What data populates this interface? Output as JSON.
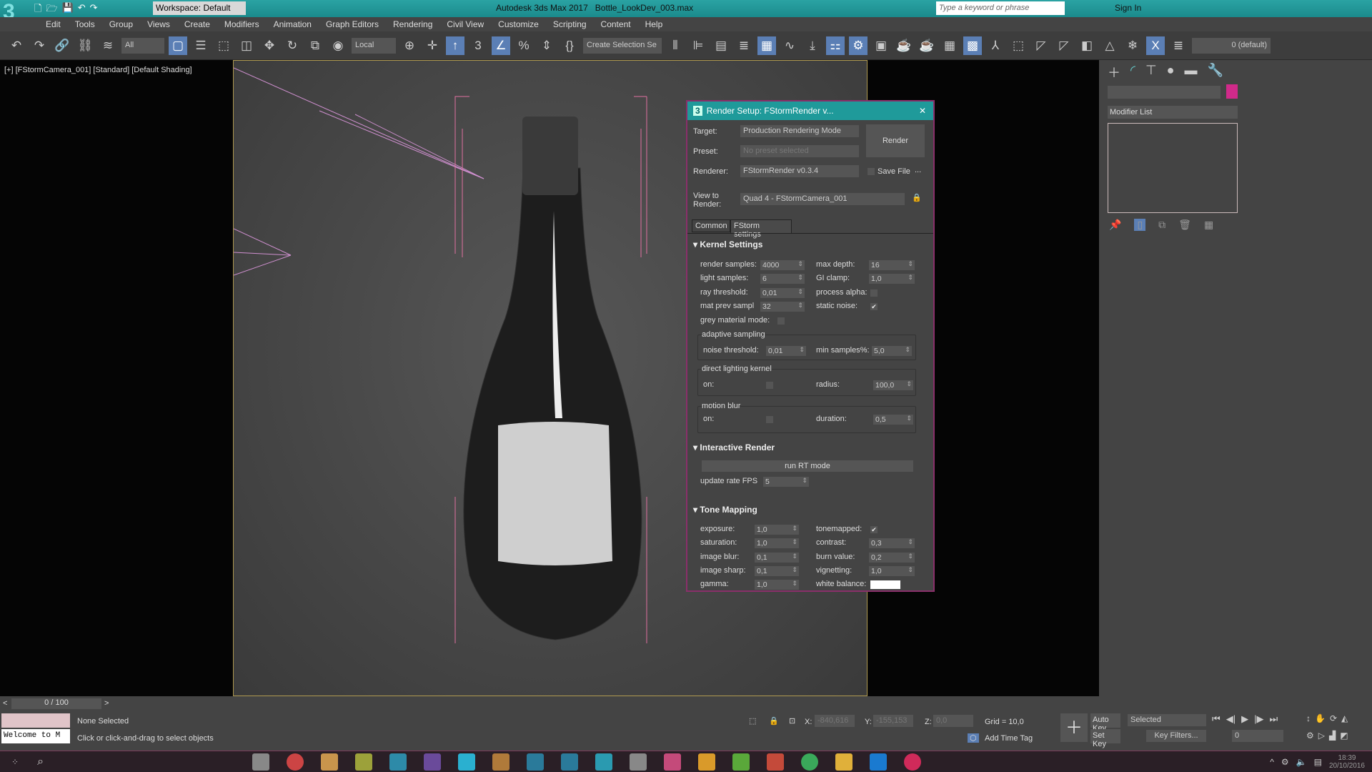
{
  "app": {
    "title": "Autodesk 3ds Max 2017",
    "file": "Bottle_LookDev_003.max",
    "workspace": "Workspace: Default",
    "search_placeholder": "Type a keyword or phrase",
    "sign_in": "Sign In",
    "logo": "3"
  },
  "menu": [
    "Edit",
    "Tools",
    "Group",
    "Views",
    "Create",
    "Modifiers",
    "Animation",
    "Graph Editors",
    "Rendering",
    "Civil View",
    "Customize",
    "Scripting",
    "Content",
    "Help"
  ],
  "toolbar": {
    "filter": "All",
    "coord": "Local",
    "selection_set": "Create Selection Se",
    "layer": "0 (default)"
  },
  "viewport": {
    "label": "[+] [FStormCamera_001] [Standard] [Default Shading]"
  },
  "dialog": {
    "title": "Render Setup: FStormRender v...",
    "target_label": "Target:",
    "target": "Production Rendering Mode",
    "preset_label": "Preset:",
    "preset": "No preset selected",
    "renderer_label": "Renderer:",
    "renderer": "FStormRender v0.3.4",
    "save_file": "Save File",
    "more": "...",
    "view_label": "View to Render:",
    "view": "Quad 4 - FStormCamera_001",
    "render_button": "Render",
    "tabs": [
      "Common",
      "FStorm settings"
    ],
    "kernel": {
      "title": "Kernel Settings",
      "render_samples_l": "render samples:",
      "render_samples": "4000",
      "max_depth_l": "max depth:",
      "max_depth": "16",
      "light_samples_l": "light samples:",
      "light_samples": "6",
      "gi_clamp_l": "GI clamp:",
      "gi_clamp": "1,0",
      "ray_threshold_l": "ray threshold:",
      "ray_threshold": "0,01",
      "process_alpha_l": "process alpha:",
      "mat_prev_l": "mat prev sampl",
      "mat_prev": "32",
      "static_noise_l": "static noise:",
      "grey_l": "grey material mode:",
      "adaptive": "adaptive sampling",
      "noise_l": "noise threshold:",
      "noise": "0,01",
      "min_samples_l": "min samples%:",
      "min_samples": "5,0",
      "dlk": "direct lighting kernel",
      "on_l": "on:",
      "radius_l": "radius:",
      "radius": "100,0",
      "mb": "motion blur",
      "duration_l": "duration:",
      "duration": "0,5"
    },
    "interactive": {
      "title": "Interactive Render",
      "rt": "run RT mode",
      "fps_l": "update rate FPS",
      "fps": "5"
    },
    "tone": {
      "title": "Tone Mapping",
      "exposure_l": "exposure:",
      "exposure": "1,0",
      "tonemapped_l": "tonemapped:",
      "saturation_l": "saturation:",
      "saturation": "1,0",
      "contrast_l": "contrast:",
      "contrast": "0,3",
      "blur_l": "image blur:",
      "blur": "0,1",
      "burn_l": "burn value:",
      "burn": "0,2",
      "sharp_l": "image sharp:",
      "sharp": "0,1",
      "vignetting_l": "vignetting:",
      "vignetting": "1,0",
      "gamma_l": "gamma:",
      "gamma": "1,0",
      "wb_l": "white balance:"
    }
  },
  "command_panel": {
    "modifier_list": "Modifier List",
    "color": "#d02a8a"
  },
  "timeline": {
    "frame": "0 / 100"
  },
  "status": {
    "selected": "None Selected",
    "prompt": "Click or click-and-drag to select objects",
    "listener": "Welcome to M",
    "x_l": "X:",
    "x": "-840,616",
    "y_l": "Y:",
    "y": "-155,153",
    "z_l": "Z:",
    "z": "0,0",
    "grid": "Grid = 10,0",
    "add_time_tag": "Add Time Tag",
    "auto_key": "Auto Key",
    "set_key": "Set Key",
    "key_mode": "Selected",
    "key_filters": "Key Filters...",
    "frame": "0"
  },
  "taskbar": {
    "time": "18:39",
    "date": "20/10/2016"
  }
}
